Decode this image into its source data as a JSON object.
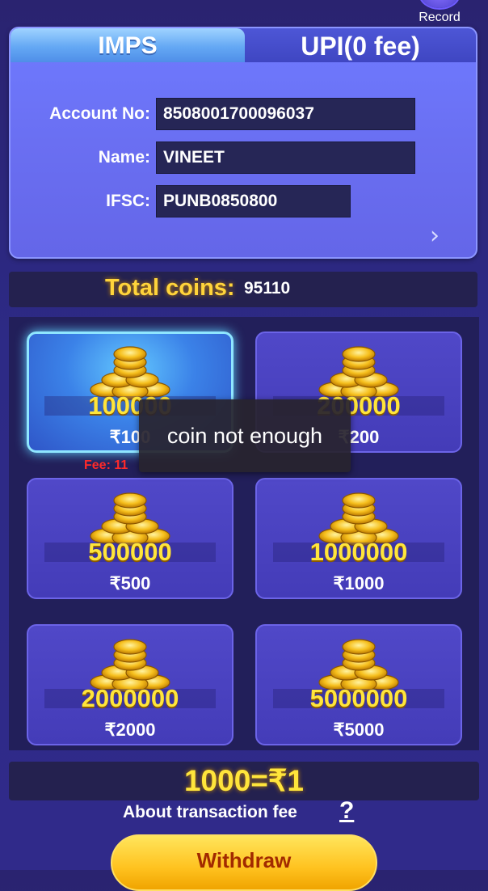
{
  "header": {
    "record_label": "Record"
  },
  "tabs": [
    {
      "label": "IMPS",
      "active": true
    },
    {
      "label": "UPI(0 fee)",
      "active": false
    }
  ],
  "account": {
    "account_no_label": "Account No:",
    "account_no": "8508001700096037",
    "name_label": "Name:",
    "name": "VINEET",
    "ifsc_label": "IFSC:",
    "ifsc": "PUNB0850800"
  },
  "total": {
    "label": "Total coins:",
    "value": "95110"
  },
  "options": [
    {
      "coins": "100000",
      "price": "₹100",
      "selected": true
    },
    {
      "coins": "200000",
      "price": "₹200",
      "selected": false
    },
    {
      "coins": "500000",
      "price": "₹500",
      "selected": false
    },
    {
      "coins": "1000000",
      "price": "₹1000",
      "selected": false
    },
    {
      "coins": "2000000",
      "price": "₹2000",
      "selected": false
    },
    {
      "coins": "5000000",
      "price": "₹5000",
      "selected": false
    }
  ],
  "fee_text": "Fee: 11",
  "toast": "coin not enough",
  "rate": "1000=₹1",
  "about_fee": "About transaction fee",
  "help_symbol": "?",
  "withdraw_label": "Withdraw",
  "icons": {
    "chevron": "chevron-right-icon",
    "coin": "coin-stack-icon",
    "record": "record-icon"
  },
  "colors": {
    "accent_gold": "#ffe53b",
    "fee_red": "#ff2a2a",
    "panel": "#6a6ff2"
  }
}
